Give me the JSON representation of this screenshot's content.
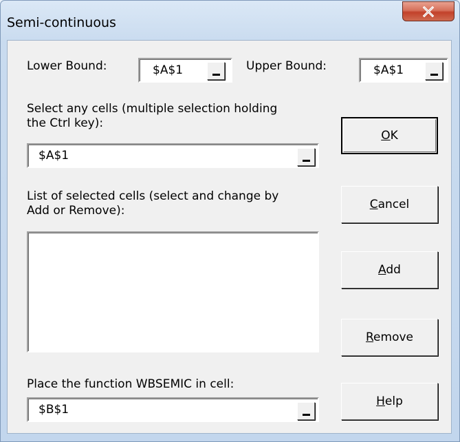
{
  "window": {
    "title": "Semi-continuous"
  },
  "lower_bound": {
    "label": "Lower Bound:",
    "value": "$A$1"
  },
  "upper_bound": {
    "label": "Upper Bound:",
    "value": "$A$1"
  },
  "select_cells": {
    "label_line1": "Select any cells (multiple selection holding",
    "label_line2": "the Ctrl key):",
    "value": "$A$1"
  },
  "selected_list": {
    "label_line1": "List of selected cells (select and change by",
    "label_line2": "Add or Remove):",
    "items": []
  },
  "function_cell": {
    "label": "Place the function WBSEMIC in cell:",
    "value": "$B$1"
  },
  "buttons": {
    "ok": {
      "accel": "O",
      "rest": "K"
    },
    "cancel": {
      "accel": "C",
      "rest": "ancel"
    },
    "add": {
      "accel": "A",
      "rest": "dd"
    },
    "remove": {
      "accel": "R",
      "rest": "emove"
    },
    "help": {
      "accel": "H",
      "rest": "elp"
    }
  },
  "icons": {
    "close": "close-icon",
    "picker": "range-picker-icon"
  }
}
